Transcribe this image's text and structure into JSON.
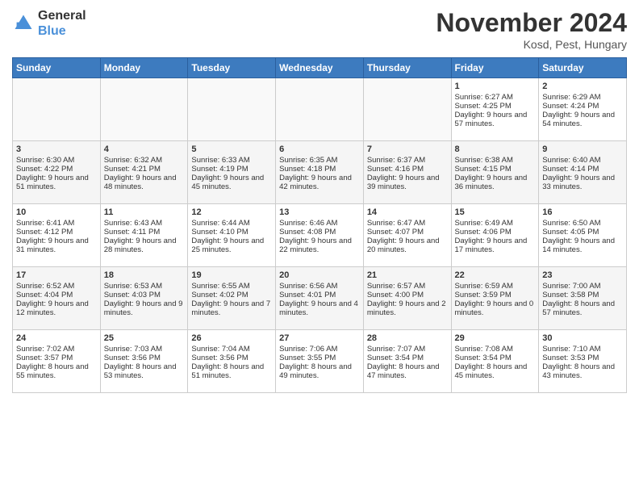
{
  "logo": {
    "line1": "General",
    "line2": "Blue"
  },
  "title": "November 2024",
  "subtitle": "Kosd, Pest, Hungary",
  "days_header": [
    "Sunday",
    "Monday",
    "Tuesday",
    "Wednesday",
    "Thursday",
    "Friday",
    "Saturday"
  ],
  "weeks": [
    [
      {
        "day": "",
        "sunrise": "",
        "sunset": "",
        "daylight": ""
      },
      {
        "day": "",
        "sunrise": "",
        "sunset": "",
        "daylight": ""
      },
      {
        "day": "",
        "sunrise": "",
        "sunset": "",
        "daylight": ""
      },
      {
        "day": "",
        "sunrise": "",
        "sunset": "",
        "daylight": ""
      },
      {
        "day": "",
        "sunrise": "",
        "sunset": "",
        "daylight": ""
      },
      {
        "day": "1",
        "sunrise": "Sunrise: 6:27 AM",
        "sunset": "Sunset: 4:25 PM",
        "daylight": "Daylight: 9 hours and 57 minutes."
      },
      {
        "day": "2",
        "sunrise": "Sunrise: 6:29 AM",
        "sunset": "Sunset: 4:24 PM",
        "daylight": "Daylight: 9 hours and 54 minutes."
      }
    ],
    [
      {
        "day": "3",
        "sunrise": "Sunrise: 6:30 AM",
        "sunset": "Sunset: 4:22 PM",
        "daylight": "Daylight: 9 hours and 51 minutes."
      },
      {
        "day": "4",
        "sunrise": "Sunrise: 6:32 AM",
        "sunset": "Sunset: 4:21 PM",
        "daylight": "Daylight: 9 hours and 48 minutes."
      },
      {
        "day": "5",
        "sunrise": "Sunrise: 6:33 AM",
        "sunset": "Sunset: 4:19 PM",
        "daylight": "Daylight: 9 hours and 45 minutes."
      },
      {
        "day": "6",
        "sunrise": "Sunrise: 6:35 AM",
        "sunset": "Sunset: 4:18 PM",
        "daylight": "Daylight: 9 hours and 42 minutes."
      },
      {
        "day": "7",
        "sunrise": "Sunrise: 6:37 AM",
        "sunset": "Sunset: 4:16 PM",
        "daylight": "Daylight: 9 hours and 39 minutes."
      },
      {
        "day": "8",
        "sunrise": "Sunrise: 6:38 AM",
        "sunset": "Sunset: 4:15 PM",
        "daylight": "Daylight: 9 hours and 36 minutes."
      },
      {
        "day": "9",
        "sunrise": "Sunrise: 6:40 AM",
        "sunset": "Sunset: 4:14 PM",
        "daylight": "Daylight: 9 hours and 33 minutes."
      }
    ],
    [
      {
        "day": "10",
        "sunrise": "Sunrise: 6:41 AM",
        "sunset": "Sunset: 4:12 PM",
        "daylight": "Daylight: 9 hours and 31 minutes."
      },
      {
        "day": "11",
        "sunrise": "Sunrise: 6:43 AM",
        "sunset": "Sunset: 4:11 PM",
        "daylight": "Daylight: 9 hours and 28 minutes."
      },
      {
        "day": "12",
        "sunrise": "Sunrise: 6:44 AM",
        "sunset": "Sunset: 4:10 PM",
        "daylight": "Daylight: 9 hours and 25 minutes."
      },
      {
        "day": "13",
        "sunrise": "Sunrise: 6:46 AM",
        "sunset": "Sunset: 4:08 PM",
        "daylight": "Daylight: 9 hours and 22 minutes."
      },
      {
        "day": "14",
        "sunrise": "Sunrise: 6:47 AM",
        "sunset": "Sunset: 4:07 PM",
        "daylight": "Daylight: 9 hours and 20 minutes."
      },
      {
        "day": "15",
        "sunrise": "Sunrise: 6:49 AM",
        "sunset": "Sunset: 4:06 PM",
        "daylight": "Daylight: 9 hours and 17 minutes."
      },
      {
        "day": "16",
        "sunrise": "Sunrise: 6:50 AM",
        "sunset": "Sunset: 4:05 PM",
        "daylight": "Daylight: 9 hours and 14 minutes."
      }
    ],
    [
      {
        "day": "17",
        "sunrise": "Sunrise: 6:52 AM",
        "sunset": "Sunset: 4:04 PM",
        "daylight": "Daylight: 9 hours and 12 minutes."
      },
      {
        "day": "18",
        "sunrise": "Sunrise: 6:53 AM",
        "sunset": "Sunset: 4:03 PM",
        "daylight": "Daylight: 9 hours and 9 minutes."
      },
      {
        "day": "19",
        "sunrise": "Sunrise: 6:55 AM",
        "sunset": "Sunset: 4:02 PM",
        "daylight": "Daylight: 9 hours and 7 minutes."
      },
      {
        "day": "20",
        "sunrise": "Sunrise: 6:56 AM",
        "sunset": "Sunset: 4:01 PM",
        "daylight": "Daylight: 9 hours and 4 minutes."
      },
      {
        "day": "21",
        "sunrise": "Sunrise: 6:57 AM",
        "sunset": "Sunset: 4:00 PM",
        "daylight": "Daylight: 9 hours and 2 minutes."
      },
      {
        "day": "22",
        "sunrise": "Sunrise: 6:59 AM",
        "sunset": "Sunset: 3:59 PM",
        "daylight": "Daylight: 9 hours and 0 minutes."
      },
      {
        "day": "23",
        "sunrise": "Sunrise: 7:00 AM",
        "sunset": "Sunset: 3:58 PM",
        "daylight": "Daylight: 8 hours and 57 minutes."
      }
    ],
    [
      {
        "day": "24",
        "sunrise": "Sunrise: 7:02 AM",
        "sunset": "Sunset: 3:57 PM",
        "daylight": "Daylight: 8 hours and 55 minutes."
      },
      {
        "day": "25",
        "sunrise": "Sunrise: 7:03 AM",
        "sunset": "Sunset: 3:56 PM",
        "daylight": "Daylight: 8 hours and 53 minutes."
      },
      {
        "day": "26",
        "sunrise": "Sunrise: 7:04 AM",
        "sunset": "Sunset: 3:56 PM",
        "daylight": "Daylight: 8 hours and 51 minutes."
      },
      {
        "day": "27",
        "sunrise": "Sunrise: 7:06 AM",
        "sunset": "Sunset: 3:55 PM",
        "daylight": "Daylight: 8 hours and 49 minutes."
      },
      {
        "day": "28",
        "sunrise": "Sunrise: 7:07 AM",
        "sunset": "Sunset: 3:54 PM",
        "daylight": "Daylight: 8 hours and 47 minutes."
      },
      {
        "day": "29",
        "sunrise": "Sunrise: 7:08 AM",
        "sunset": "Sunset: 3:54 PM",
        "daylight": "Daylight: 8 hours and 45 minutes."
      },
      {
        "day": "30",
        "sunrise": "Sunrise: 7:10 AM",
        "sunset": "Sunset: 3:53 PM",
        "daylight": "Daylight: 8 hours and 43 minutes."
      }
    ]
  ]
}
